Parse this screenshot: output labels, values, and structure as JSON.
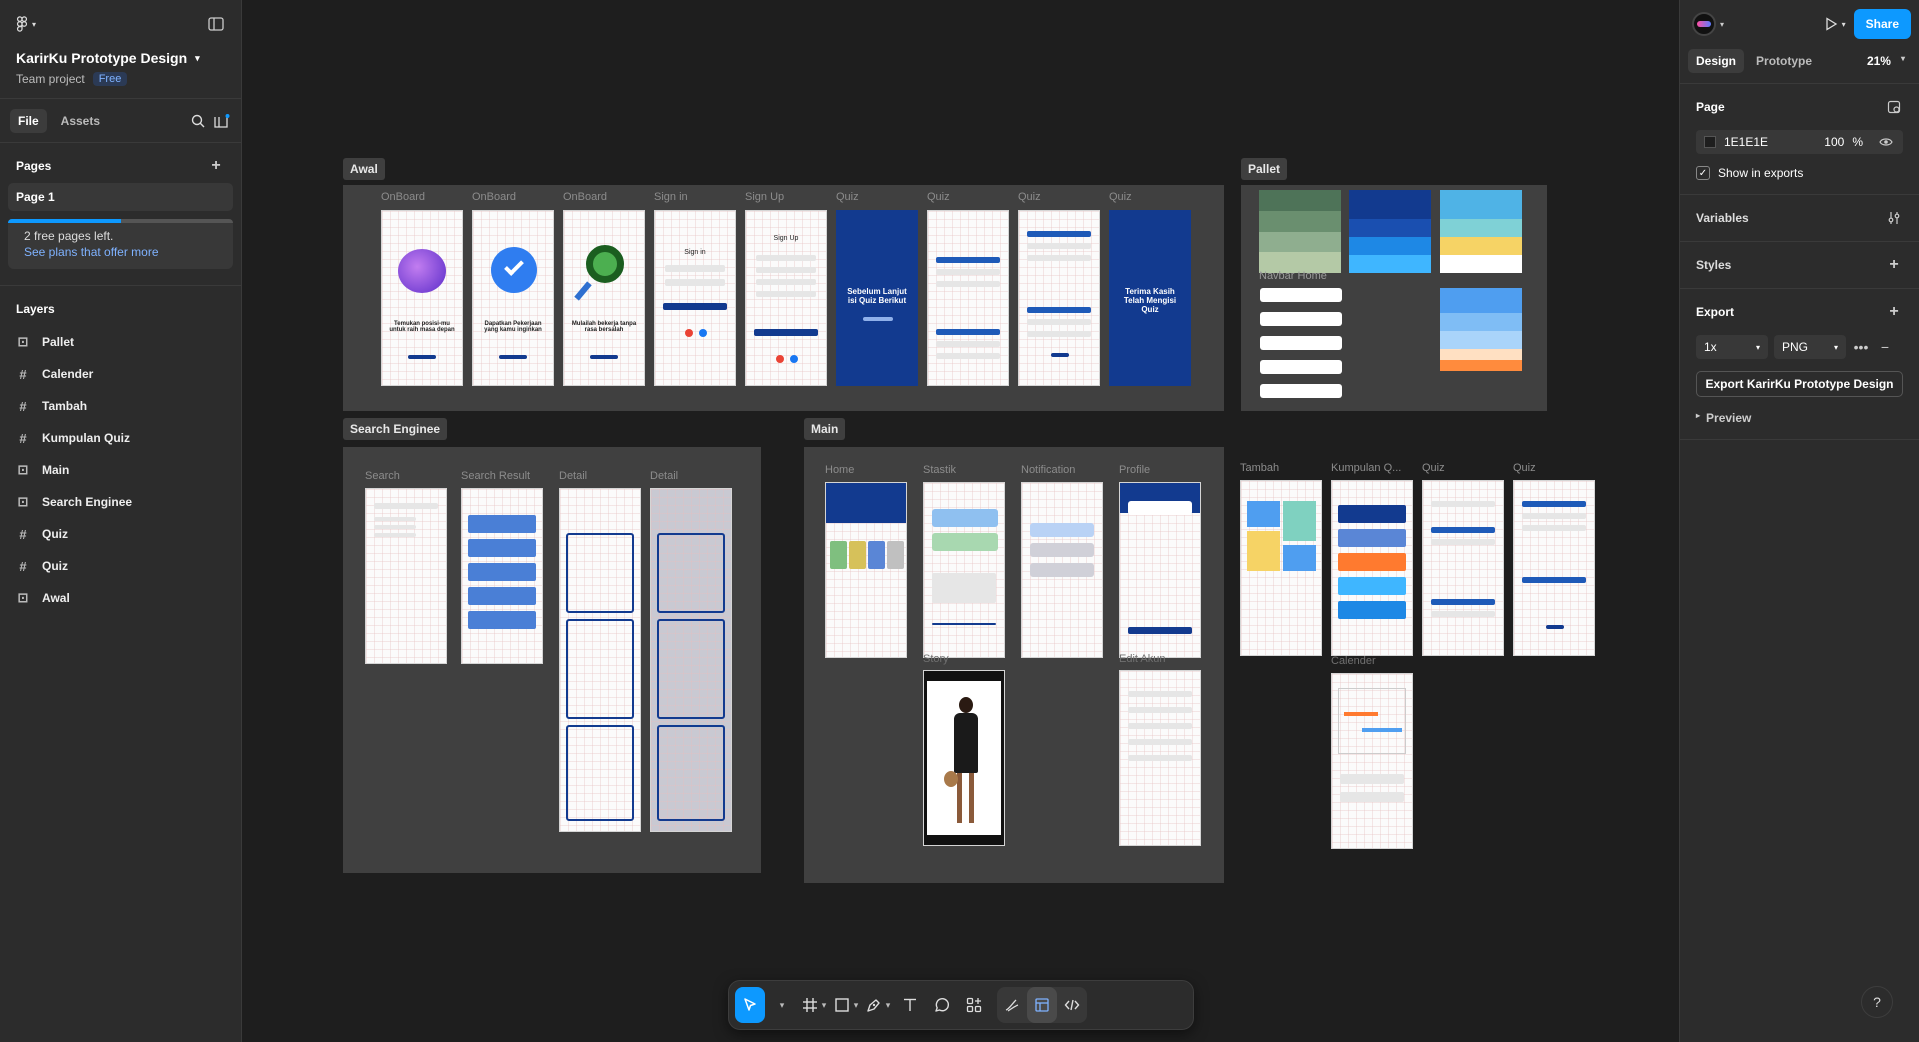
{
  "project": {
    "name": "KarirKu Prototype Design",
    "team": "Team project",
    "plan_badge": "Free"
  },
  "left_tabs": {
    "file": "File",
    "assets": "Assets"
  },
  "pages": {
    "title": "Pages",
    "items": [
      "Page 1"
    ],
    "notice_text": "2 free pages left.",
    "notice_link": "See plans that offer more",
    "notice_progress": 0.5
  },
  "layers": {
    "title": "Layers",
    "items": [
      {
        "label": "Pallet",
        "icon": "section-icon"
      },
      {
        "label": "Calender",
        "icon": "frame-icon"
      },
      {
        "label": "Tambah",
        "icon": "frame-icon"
      },
      {
        "label": "Kumpulan Quiz",
        "icon": "frame-icon"
      },
      {
        "label": "Main",
        "icon": "section-icon"
      },
      {
        "label": "Search Enginee",
        "icon": "section-icon"
      },
      {
        "label": "Quiz",
        "icon": "frame-icon"
      },
      {
        "label": "Quiz",
        "icon": "frame-icon"
      },
      {
        "label": "Awal",
        "icon": "section-icon"
      }
    ]
  },
  "right": {
    "share": "Share",
    "tabs": {
      "design": "Design",
      "prototype": "Prototype"
    },
    "zoom": "21%",
    "page_title": "Page",
    "page_fill_hex": "1E1E1E",
    "page_fill_opacity": "100",
    "page_fill_unit": "%",
    "show_in_exports": "Show in exports",
    "variables": "Variables",
    "styles": "Styles",
    "export_title": "Export",
    "export_scale": "1x",
    "export_format": "PNG",
    "export_button": "Export KarirKu Prototype Design",
    "preview": "Preview"
  },
  "canvas": {
    "sections": {
      "awal": "Awal",
      "pallet": "Pallet",
      "search": "Search Enginee",
      "main": "Main"
    },
    "awal_frames": [
      "OnBoard",
      "OnBoard",
      "OnBoard",
      "Sign in",
      "Sign Up",
      "Quiz",
      "Quiz",
      "Quiz",
      "Quiz"
    ],
    "awal_texts": {
      "ob1": "Temukan posisi-mu untuk raih masa depan",
      "ob2": "Dapatkan Pekerjaan yang kamu inginkan",
      "ob3": "Mulailah bekerja tanpa rasa bersalah",
      "signin": "Sign in",
      "signup": "Sign Up",
      "quiz1": "Sebelum Lanjut isi Quiz Berikut",
      "quiz4": "Terima Kasih Telah Mengisi Quiz"
    },
    "navbar_label": "Navbar Home",
    "search_frames": [
      "Search",
      "Search Result",
      "Detail",
      "Detail"
    ],
    "main_frames": [
      "Home",
      "Stastik",
      "Notification",
      "Profile"
    ],
    "main_frames_row2": [
      "Story",
      "Edit Akun"
    ],
    "right_frames": [
      "Tambah",
      "Kumpulan Q...",
      "Quiz",
      "Quiz"
    ],
    "calender_label": "Calender"
  },
  "palette_colors": {
    "greens": [
      "#4e7358",
      "#6a8f6f",
      "#8fae8f",
      "#b4c9a6"
    ],
    "blues": [
      "#123a8f",
      "#1a4fb0",
      "#1e88e5",
      "#3fb6ff"
    ],
    "sky": [
      "#4fb3e6",
      "#7fd1d6",
      "#f6d365",
      "#ffffff"
    ],
    "soft": [
      "#4f9ef0",
      "#7fbdf5",
      "#a9d4fa",
      "#ffe0c2",
      "#ff8b3d"
    ]
  }
}
